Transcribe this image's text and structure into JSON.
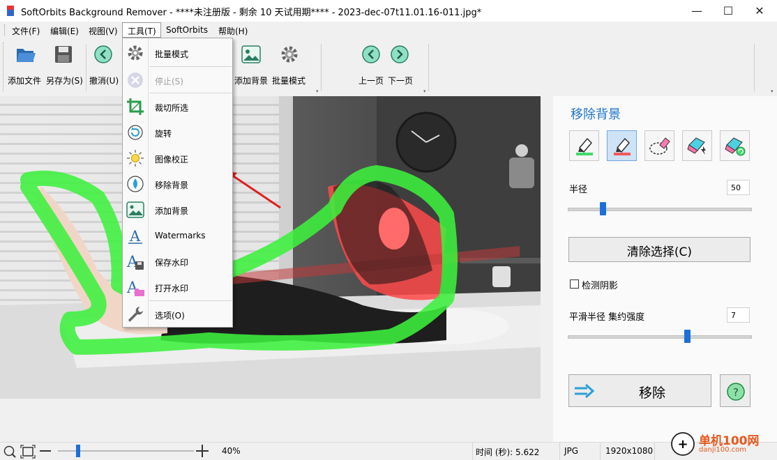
{
  "window": {
    "title": "SoftOrbits Background Remover - ****未注册版 - 剩余 10 天试用期**** - 2023-dec-07t11.01.16-011.jpg*",
    "minimize_glyph": "—",
    "maximize_glyph": "☐",
    "close_glyph": "✕"
  },
  "menubar": {
    "items": [
      {
        "label": "文件(F)"
      },
      {
        "label": "编辑(E)"
      },
      {
        "label": "视图(V)"
      },
      {
        "label": "工具(T)"
      },
      {
        "label": "SoftOrbits"
      },
      {
        "label": "帮助(H)"
      }
    ]
  },
  "toolbar": {
    "add_file": "添加文件",
    "save_as": "另存为(S)",
    "undo": "撤消(U)",
    "add_background": "添加背景",
    "batch_mode": "批量模式",
    "prev_page": "上一页",
    "next_page": "下一页"
  },
  "tools_menu": {
    "items": [
      {
        "label": "批量模式",
        "icon": "gear-icon",
        "enabled": true
      },
      {
        "label": "停止(S)",
        "icon": "stop-icon",
        "enabled": false
      },
      {
        "label": "裁切所选",
        "icon": "crop-icon",
        "enabled": true
      },
      {
        "label": "旋转",
        "icon": "rotate-icon",
        "enabled": true
      },
      {
        "label": "图像校正",
        "icon": "sun-icon",
        "enabled": true
      },
      {
        "label": "移除背景",
        "icon": "remove-bg-icon",
        "enabled": true
      },
      {
        "label": "添加背景",
        "icon": "add-bg-icon",
        "enabled": true
      },
      {
        "label": "Watermarks",
        "icon": "watermark-icon",
        "enabled": true
      },
      {
        "label": "保存水印",
        "icon": "save-watermark-icon",
        "enabled": true
      },
      {
        "label": "打开水印",
        "icon": "open-watermark-icon",
        "enabled": true
      },
      {
        "label": "选项(O)",
        "icon": "wrench-icon",
        "enabled": true
      }
    ]
  },
  "panel": {
    "title": "移除背景",
    "tools": [
      {
        "icon": "keep-marker-icon"
      },
      {
        "icon": "remove-marker-icon",
        "selected": true
      },
      {
        "icon": "lasso-eraser-icon"
      },
      {
        "icon": "auto-eraser-icon"
      },
      {
        "icon": "refresh-eraser-icon"
      }
    ],
    "radius_label": "半径",
    "radius_value": "50",
    "radius_level": 0.18,
    "clear_selection": "清除选择(C)",
    "detect_shadow": "检测阴影",
    "detect_shadow_checked": false,
    "smooth_label": "平滑半径 集约强度",
    "smooth_value": "7",
    "smooth_level": 0.66,
    "remove_button": "移除",
    "help_glyph": "?"
  },
  "statusbar": {
    "zoom": "40%",
    "zoom_level": 0.14,
    "time": "时间 (秒): 5.622",
    "format": "JPG",
    "dimensions": "1920x1080"
  },
  "watermark": {
    "site": "单机100网",
    "domain": "danji100.com"
  },
  "colors": {
    "accent": "#1e6fd9",
    "panel_title": "#1e73c8",
    "keep_stroke": "#3ef03e",
    "remove_stroke": "#ff3c3c"
  }
}
